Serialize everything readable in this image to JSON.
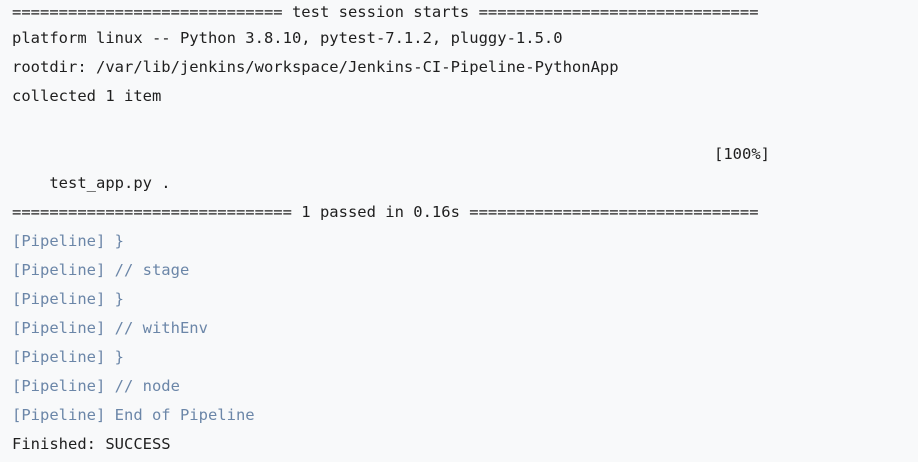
{
  "console": {
    "session_header": "============================= test session starts ==============================",
    "platform_line": "platform linux -- Python 3.8.10, pytest-7.1.2, pluggy-1.5.0",
    "rootdir_line": "rootdir: /var/lib/jenkins/workspace/Jenkins-CI-Pipeline-PythonApp",
    "collected_line": "collected 1 item",
    "test_file_line": "test_app.py .",
    "test_progress": "[100%]",
    "summary_line": "============================== 1 passed in 0.16s ===============================",
    "pipeline_lines": [
      "[Pipeline] }",
      "[Pipeline] // stage",
      "[Pipeline] }",
      "[Pipeline] // withEnv",
      "[Pipeline] }",
      "[Pipeline] // node",
      "[Pipeline] End of Pipeline"
    ],
    "finished_line": "Finished: SUCCESS"
  },
  "colors": {
    "background": "#f8f9fa",
    "text": "#1f1f1f",
    "pipeline_text": "#6b86a8"
  }
}
